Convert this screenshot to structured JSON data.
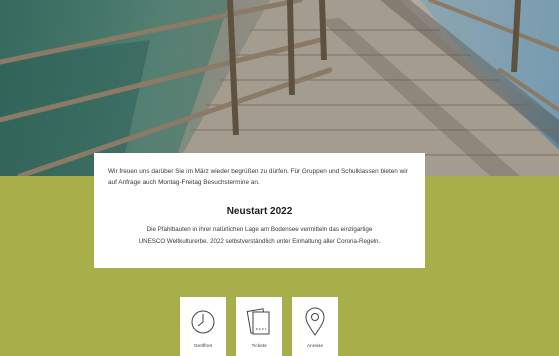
{
  "hero": {
    "image_description_icon": "wooden-boardwalk-photo"
  },
  "info_card": {
    "intro": "Wir freuen uns darüber Sie im März wieder begrüßen zu dürfen. Für Gruppen und Schulklassen bieten wir auf Anfrage auch Montag-Freitag Besuchstermine an.",
    "headline": "Neustart 2022",
    "body_line1": "Die Pfahlbauten in ihrer natürlichen Lage am Bodensee vermitteln das einzigartige",
    "body_line2": "UNESCO Weltkulturerbe. 2022 selbstverständlich unter Einhaltung aller Corona-Regeln."
  },
  "tiles": [
    {
      "label": "Geöffnet",
      "icon": "clock-icon"
    },
    {
      "label": "Tickets",
      "icon": "tickets-icon"
    },
    {
      "label": "Anreise",
      "icon": "location-pin-icon"
    }
  ],
  "colors": {
    "olive": "#a7ae4a",
    "card": "#ffffff"
  }
}
